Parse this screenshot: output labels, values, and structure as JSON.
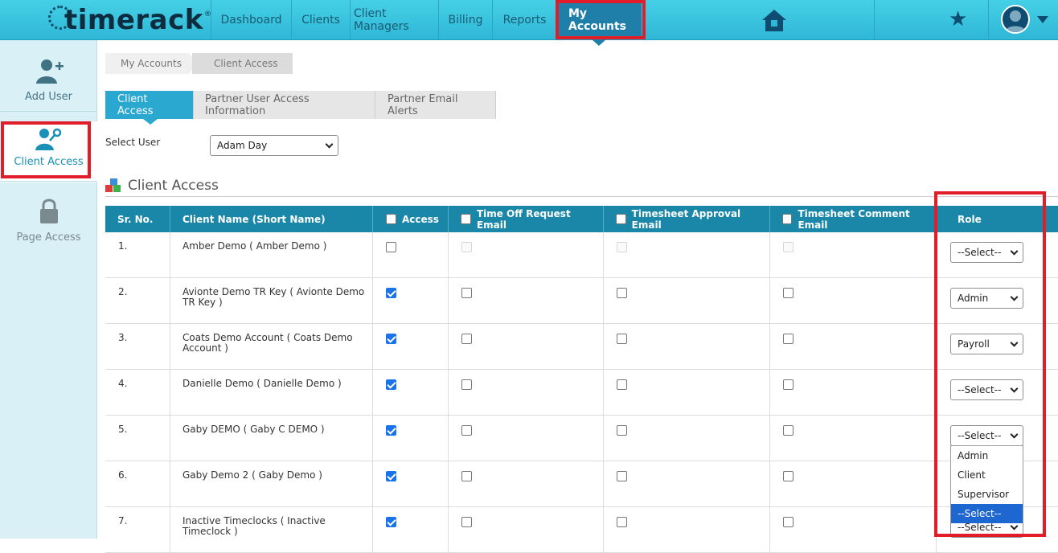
{
  "app": {
    "logo_text": "timerack",
    "logo_reg": "®"
  },
  "nav": {
    "items": [
      "Dashboard",
      "Clients",
      "Client Managers",
      "Billing",
      "Reports",
      "My Accounts"
    ],
    "active": "My Accounts"
  },
  "sidebar": {
    "items": [
      "Add User",
      "Client Access",
      "Page Access"
    ],
    "active": "Client Access"
  },
  "breadcrumb": [
    "My Accounts",
    "Client Access"
  ],
  "tabs": [
    "Client Access",
    "Partner User Access Information",
    "Partner Email Alerts"
  ],
  "select_user": {
    "label": "Select User",
    "value": "Adam Day"
  },
  "section_title": "Client Access",
  "table": {
    "headers": [
      "Sr. No.",
      "Client Name (Short Name)",
      "Access",
      "Time Off Request Email",
      "Timesheet Approval Email",
      "Timesheet Comment Email",
      "Role"
    ],
    "rows": [
      {
        "sr": "1.",
        "name": "Amber Demo ( Amber Demo )",
        "access": false,
        "timeoff": false,
        "approval": false,
        "comment": false,
        "disabled": true,
        "role": "--Select--"
      },
      {
        "sr": "2.",
        "name": "Avionte Demo TR Key ( Avionte Demo TR Key )",
        "access": true,
        "timeoff": false,
        "approval": false,
        "comment": false,
        "disabled": false,
        "role": "Admin"
      },
      {
        "sr": "3.",
        "name": "Coats Demo Account ( Coats Demo Account )",
        "access": true,
        "timeoff": false,
        "approval": false,
        "comment": false,
        "disabled": false,
        "role": "Payroll"
      },
      {
        "sr": "4.",
        "name": "Danielle Demo ( Danielle Demo )",
        "access": true,
        "timeoff": false,
        "approval": false,
        "comment": false,
        "disabled": false,
        "role": "--Select--"
      },
      {
        "sr": "5.",
        "name": "Gaby DEMO ( Gaby C DEMO )",
        "access": true,
        "timeoff": false,
        "approval": false,
        "comment": false,
        "disabled": false,
        "role": "--Select--"
      },
      {
        "sr": "6.",
        "name": "Gaby Demo 2 ( Gaby Demo )",
        "access": true,
        "timeoff": false,
        "approval": false,
        "comment": false,
        "disabled": false,
        "role": ""
      },
      {
        "sr": "7.",
        "name": "Inactive Timeclocks ( Inactive Timeclock )",
        "access": true,
        "timeoff": false,
        "approval": false,
        "comment": false,
        "disabled": false,
        "role": "--Select--"
      }
    ]
  },
  "role_dropdown": {
    "options": [
      "Admin",
      "Client",
      "Supervisor",
      "--Select--"
    ],
    "highlighted": "--Select--"
  },
  "colors": {
    "topbar": "#2fb7d6",
    "nav_active": "#1f7fa8",
    "table_header": "#1a87a8",
    "highlight_box": "#e11d2a",
    "sidebar_active_text": "#1a8fb8"
  }
}
